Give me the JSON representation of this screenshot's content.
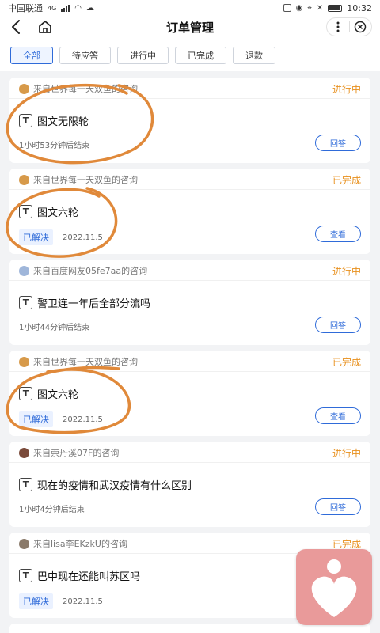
{
  "status_bar": {
    "carrier": "中国联通",
    "signal_label": "4G",
    "time": "10:32",
    "battery_icon": "battery-icon",
    "nfc_icon": "nfc-icon"
  },
  "nav": {
    "title": "订单管理",
    "back_icon": "chevron-left-icon",
    "home_icon": "home-icon",
    "more_icon": "more-vertical-icon",
    "close_icon": "close-circle-icon"
  },
  "filters": [
    {
      "label": "全部",
      "active": true
    },
    {
      "label": "待应答",
      "active": false
    },
    {
      "label": "进行中",
      "active": false
    },
    {
      "label": "已完成",
      "active": false
    },
    {
      "label": "退款",
      "active": false
    }
  ],
  "orders": [
    {
      "source": "来自世界每一天双鱼的咨询",
      "status": "进行中",
      "title": "图文无限轮",
      "meta": "1小时53分钟后结束",
      "badge": "",
      "date": "",
      "action": "回答",
      "avatar_color": "#d79a4a"
    },
    {
      "source": "来自世界每一天双鱼的咨询",
      "status": "已完成",
      "title": "图文六轮",
      "meta": "",
      "badge": "已解决",
      "date": "2022.11.5",
      "action": "查看",
      "avatar_color": "#d79a4a"
    },
    {
      "source": "来自百度网友05fe7aa的咨询",
      "status": "进行中",
      "title": "警卫连一年后全部分流吗",
      "meta": "1小时44分钟后结束",
      "badge": "",
      "date": "",
      "action": "回答",
      "avatar_color": "#9fb6da"
    },
    {
      "source": "来自世界每一天双鱼的咨询",
      "status": "已完成",
      "title": "图文六轮",
      "meta": "",
      "badge": "已解决",
      "date": "2022.11.5",
      "action": "查看",
      "avatar_color": "#d79a4a"
    },
    {
      "source": "来自崇丹溪07F的咨询",
      "status": "进行中",
      "title": "现在的疫情和武汉疫情有什么区别",
      "meta": "1小时4分钟后结束",
      "badge": "",
      "date": "",
      "action": "回答",
      "avatar_color": "#7a4a3a"
    },
    {
      "source": "来自lisa李EKzkU的咨询",
      "status": "已完成",
      "title": "巴中现在还能叫苏区吗",
      "meta": "",
      "badge": "已解决",
      "date": "2022.11.5",
      "action": "",
      "avatar_color": "#8a7a6a"
    }
  ],
  "floating_app": {
    "icon": "heart-app-icon"
  },
  "colors": {
    "accent": "#2f6bd9",
    "status": "#e8901d",
    "annotation": "#e0893a"
  }
}
